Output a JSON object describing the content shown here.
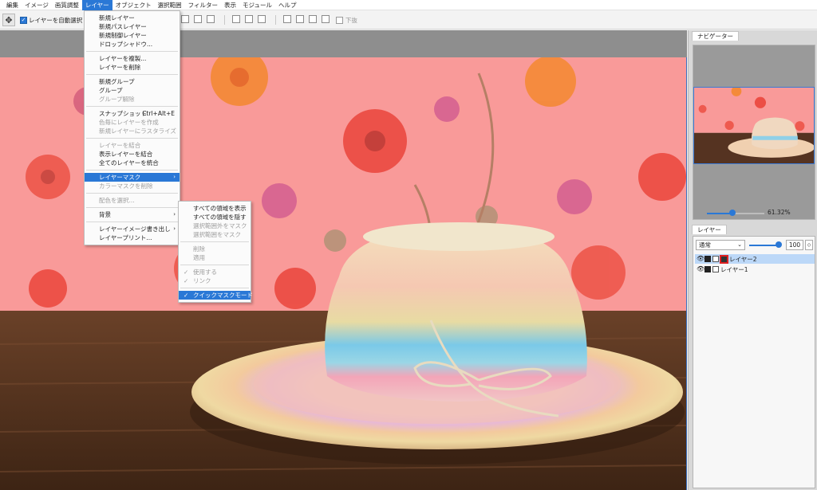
{
  "menubar": {
    "items": [
      "編集",
      "イメージ",
      "画質調整",
      "レイヤー",
      "オブジェクト",
      "選択範囲",
      "フィルター",
      "表示",
      "モジュール",
      "ヘルプ"
    ]
  },
  "toolbar": {
    "auto_select_label": "レイヤーを自動選択",
    "auto_select_checked": true,
    "bottom_label": "下抜",
    "bottom_checked": false
  },
  "layer_menu": {
    "items": [
      {
        "label": "新規レイヤー"
      },
      {
        "label": "新規パスレイヤー"
      },
      {
        "label": "新規制御レイヤー"
      },
      {
        "label": "ドロップシャドウ..."
      },
      {
        "sep": true
      },
      {
        "label": "レイヤーを複製..."
      },
      {
        "label": "レイヤーを削除"
      },
      {
        "sep": true
      },
      {
        "label": "新規グループ"
      },
      {
        "label": "グループ"
      },
      {
        "label": "グループ解除",
        "disabled": true
      },
      {
        "sep": true
      },
      {
        "label": "スナップショット",
        "shortcut": "Ctrl+Alt+E"
      },
      {
        "label": "色毎にレイヤーを作成",
        "disabled": true
      },
      {
        "label": "新規レイヤーにラスタライズ",
        "disabled": true
      },
      {
        "sep": true
      },
      {
        "label": "レイヤーを結合",
        "disabled": true
      },
      {
        "label": "表示レイヤーを結合"
      },
      {
        "label": "全てのレイヤーを統合"
      },
      {
        "sep": true
      },
      {
        "label": "レイヤーマスク",
        "submenu": true,
        "highlight": true
      },
      {
        "label": "カラーマスクを削除",
        "disabled": true
      },
      {
        "sep": true
      },
      {
        "label": "配色を選択...",
        "disabled": true
      },
      {
        "sep": true
      },
      {
        "label": "背景",
        "submenu": true
      },
      {
        "sep": true
      },
      {
        "label": "レイヤーイメージ書き出し",
        "submenu": true
      },
      {
        "label": "レイヤープリント..."
      }
    ]
  },
  "mask_submenu": {
    "items": [
      {
        "label": "すべての領域を表示"
      },
      {
        "label": "すべての領域を隠す"
      },
      {
        "label": "選択範囲外をマスク",
        "disabled": true
      },
      {
        "label": "選択範囲をマスク",
        "disabled": true
      },
      {
        "sep": true
      },
      {
        "label": "削除",
        "disabled": true
      },
      {
        "label": "適用",
        "disabled": true
      },
      {
        "sep": true
      },
      {
        "label": "使用する",
        "disabled": true,
        "checked": true
      },
      {
        "label": "リンク",
        "disabled": true,
        "checked": true
      },
      {
        "sep": true
      },
      {
        "label": "クイックマスクモード",
        "checked": true,
        "highlight": true
      }
    ]
  },
  "navigator": {
    "tab_label": "ナビゲーター",
    "zoom_value": "61.32%",
    "zoom_fraction": 0.45
  },
  "layers": {
    "tab_label": "レイヤー",
    "blend_mode": "通常",
    "opacity_value": "100",
    "items": [
      {
        "name": "レイヤー2",
        "selected": true
      },
      {
        "name": "レイヤー1",
        "selected": false
      }
    ]
  },
  "colors": {
    "accent": "#2a78d6",
    "wallpaper": "#f99a99",
    "table": "#5a3823",
    "mask_highlight": "#e02020"
  }
}
